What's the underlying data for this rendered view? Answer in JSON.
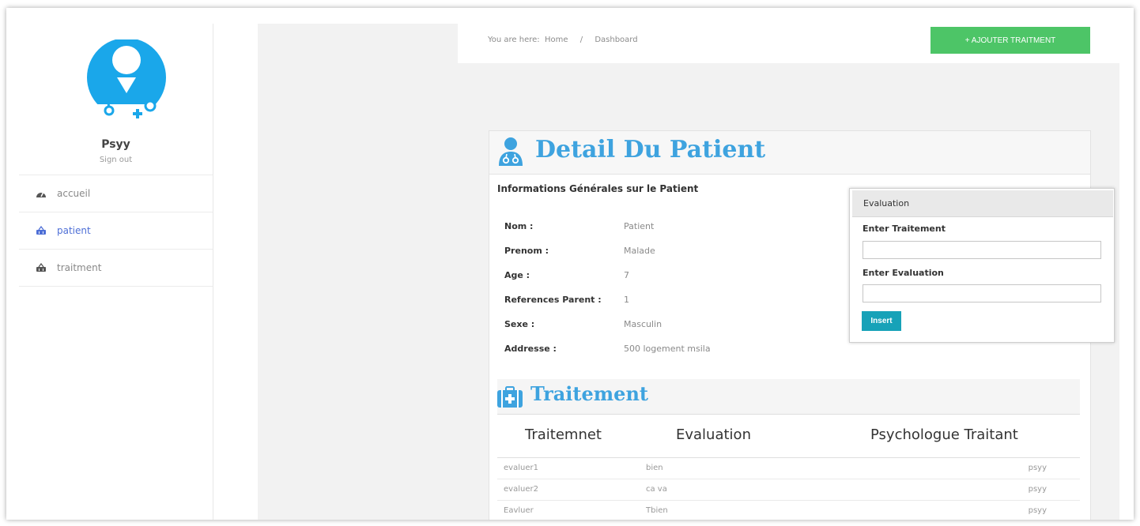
{
  "sidebar": {
    "user_name": "Psyy",
    "sign_out": "Sign out",
    "menu": [
      {
        "label": "accueil",
        "icon": "dashboard-icon"
      },
      {
        "label": "patient",
        "icon": "basket-icon"
      },
      {
        "label": "traitment",
        "icon": "basket-icon"
      }
    ]
  },
  "breadcrumb": {
    "prefix": "You are here:",
    "home": "Home",
    "separator": "/",
    "current": "Dashboard"
  },
  "header": {
    "add_button": "+ AJOUTER TRAITMENT"
  },
  "patient": {
    "title": "Detail Du Patient",
    "section_title": "Informations Générales sur le Patient",
    "fields": [
      {
        "label": "Nom :",
        "value": "Patient"
      },
      {
        "label": "Prenom :",
        "value": "Malade"
      },
      {
        "label": "Age :",
        "value": "7"
      },
      {
        "label": "References Parent :",
        "value": "1"
      },
      {
        "label": "Sexe :",
        "value": "Masculin"
      },
      {
        "label": "Addresse :",
        "value": "500 logement msila"
      }
    ]
  },
  "evaluation": {
    "title": "Evaluation",
    "traitement_label": "Enter Traitement",
    "evaluation_label": "Enter Evaluation",
    "insert_button": "Insert"
  },
  "traitement": {
    "title": "Traitement",
    "columns": [
      "Traitemnet",
      "Evaluation",
      "Psychologue Traitant"
    ],
    "rows": [
      [
        "evaluer1",
        "bien",
        "psyy"
      ],
      [
        "evaluer2",
        "ca va",
        "psyy"
      ],
      [
        "Eavluer",
        "Tbien",
        "psyy"
      ]
    ]
  },
  "colors": {
    "accent_blue": "#3ea3df",
    "active_link": "#4e6fd6",
    "add_button_green": "#4dc567",
    "insert_button_teal": "#17a2b8"
  }
}
